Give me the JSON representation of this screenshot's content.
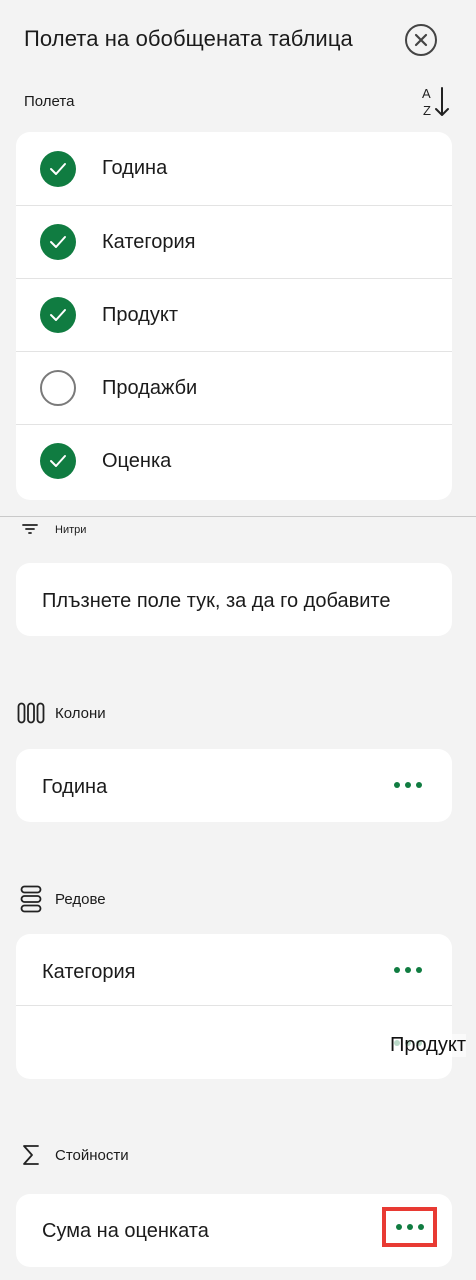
{
  "header": {
    "title": "Полета на обобщената таблица",
    "close_icon": "close-circle-icon",
    "fields_label": "Полета",
    "sort_icon": "sort-a-z-icon"
  },
  "fields": [
    {
      "label": "Година",
      "checked": true
    },
    {
      "label": "Категория",
      "checked": true
    },
    {
      "label": "Продукт",
      "checked": true
    },
    {
      "label": "Продажби",
      "checked": false
    },
    {
      "label": "Оценка",
      "checked": true
    }
  ],
  "filters": {
    "label": "Нитри",
    "icon": "filter-icon",
    "placeholder": "Плъзнете поле тук, за да го добавите"
  },
  "columns": {
    "label": "Колони",
    "icon": "columns-icon",
    "items": [
      "Година"
    ]
  },
  "rows": {
    "label": "Редове",
    "icon": "rows-icon",
    "items": [
      "Категория",
      ""
    ]
  },
  "dragging_item": "Продукт",
  "values": {
    "label": "Стойности",
    "icon": "sigma-icon",
    "items": [
      "Сума на оценката"
    ]
  },
  "colors": {
    "accent": "#107c41",
    "highlight": "#e83a33",
    "background": "#f3f3f3"
  }
}
